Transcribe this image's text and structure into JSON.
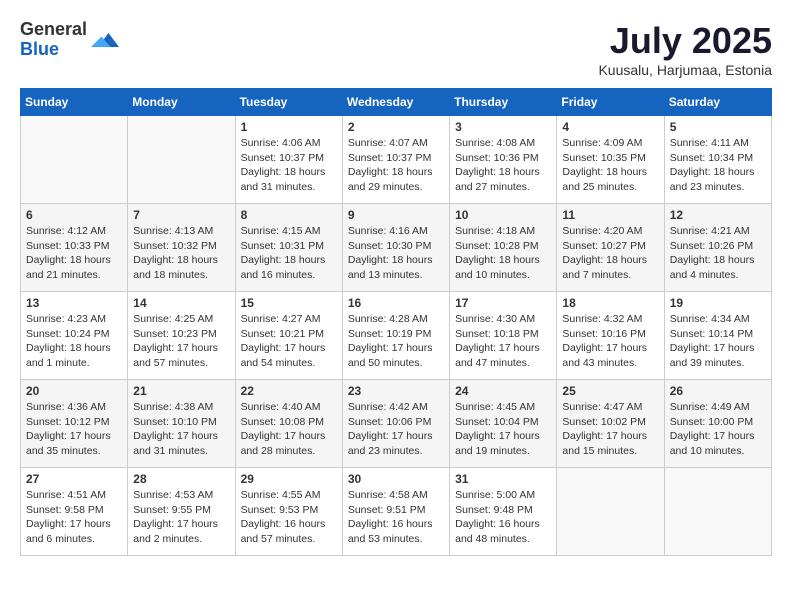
{
  "header": {
    "logo_general": "General",
    "logo_blue": "Blue",
    "month_year": "July 2025",
    "location": "Kuusalu, Harjumaa, Estonia"
  },
  "days_of_week": [
    "Sunday",
    "Monday",
    "Tuesday",
    "Wednesday",
    "Thursday",
    "Friday",
    "Saturday"
  ],
  "weeks": [
    [
      {
        "day": "",
        "sunrise": "",
        "sunset": "",
        "daylight": "",
        "empty": true
      },
      {
        "day": "",
        "sunrise": "",
        "sunset": "",
        "daylight": "",
        "empty": true
      },
      {
        "day": "1",
        "sunrise": "Sunrise: 4:06 AM",
        "sunset": "Sunset: 10:37 PM",
        "daylight": "Daylight: 18 hours and 31 minutes."
      },
      {
        "day": "2",
        "sunrise": "Sunrise: 4:07 AM",
        "sunset": "Sunset: 10:37 PM",
        "daylight": "Daylight: 18 hours and 29 minutes."
      },
      {
        "day": "3",
        "sunrise": "Sunrise: 4:08 AM",
        "sunset": "Sunset: 10:36 PM",
        "daylight": "Daylight: 18 hours and 27 minutes."
      },
      {
        "day": "4",
        "sunrise": "Sunrise: 4:09 AM",
        "sunset": "Sunset: 10:35 PM",
        "daylight": "Daylight: 18 hours and 25 minutes."
      },
      {
        "day": "5",
        "sunrise": "Sunrise: 4:11 AM",
        "sunset": "Sunset: 10:34 PM",
        "daylight": "Daylight: 18 hours and 23 minutes."
      }
    ],
    [
      {
        "day": "6",
        "sunrise": "Sunrise: 4:12 AM",
        "sunset": "Sunset: 10:33 PM",
        "daylight": "Daylight: 18 hours and 21 minutes."
      },
      {
        "day": "7",
        "sunrise": "Sunrise: 4:13 AM",
        "sunset": "Sunset: 10:32 PM",
        "daylight": "Daylight: 18 hours and 18 minutes."
      },
      {
        "day": "8",
        "sunrise": "Sunrise: 4:15 AM",
        "sunset": "Sunset: 10:31 PM",
        "daylight": "Daylight: 18 hours and 16 minutes."
      },
      {
        "day": "9",
        "sunrise": "Sunrise: 4:16 AM",
        "sunset": "Sunset: 10:30 PM",
        "daylight": "Daylight: 18 hours and 13 minutes."
      },
      {
        "day": "10",
        "sunrise": "Sunrise: 4:18 AM",
        "sunset": "Sunset: 10:28 PM",
        "daylight": "Daylight: 18 hours and 10 minutes."
      },
      {
        "day": "11",
        "sunrise": "Sunrise: 4:20 AM",
        "sunset": "Sunset: 10:27 PM",
        "daylight": "Daylight: 18 hours and 7 minutes."
      },
      {
        "day": "12",
        "sunrise": "Sunrise: 4:21 AM",
        "sunset": "Sunset: 10:26 PM",
        "daylight": "Daylight: 18 hours and 4 minutes."
      }
    ],
    [
      {
        "day": "13",
        "sunrise": "Sunrise: 4:23 AM",
        "sunset": "Sunset: 10:24 PM",
        "daylight": "Daylight: 18 hours and 1 minute."
      },
      {
        "day": "14",
        "sunrise": "Sunrise: 4:25 AM",
        "sunset": "Sunset: 10:23 PM",
        "daylight": "Daylight: 17 hours and 57 minutes."
      },
      {
        "day": "15",
        "sunrise": "Sunrise: 4:27 AM",
        "sunset": "Sunset: 10:21 PM",
        "daylight": "Daylight: 17 hours and 54 minutes."
      },
      {
        "day": "16",
        "sunrise": "Sunrise: 4:28 AM",
        "sunset": "Sunset: 10:19 PM",
        "daylight": "Daylight: 17 hours and 50 minutes."
      },
      {
        "day": "17",
        "sunrise": "Sunrise: 4:30 AM",
        "sunset": "Sunset: 10:18 PM",
        "daylight": "Daylight: 17 hours and 47 minutes."
      },
      {
        "day": "18",
        "sunrise": "Sunrise: 4:32 AM",
        "sunset": "Sunset: 10:16 PM",
        "daylight": "Daylight: 17 hours and 43 minutes."
      },
      {
        "day": "19",
        "sunrise": "Sunrise: 4:34 AM",
        "sunset": "Sunset: 10:14 PM",
        "daylight": "Daylight: 17 hours and 39 minutes."
      }
    ],
    [
      {
        "day": "20",
        "sunrise": "Sunrise: 4:36 AM",
        "sunset": "Sunset: 10:12 PM",
        "daylight": "Daylight: 17 hours and 35 minutes."
      },
      {
        "day": "21",
        "sunrise": "Sunrise: 4:38 AM",
        "sunset": "Sunset: 10:10 PM",
        "daylight": "Daylight: 17 hours and 31 minutes."
      },
      {
        "day": "22",
        "sunrise": "Sunrise: 4:40 AM",
        "sunset": "Sunset: 10:08 PM",
        "daylight": "Daylight: 17 hours and 28 minutes."
      },
      {
        "day": "23",
        "sunrise": "Sunrise: 4:42 AM",
        "sunset": "Sunset: 10:06 PM",
        "daylight": "Daylight: 17 hours and 23 minutes."
      },
      {
        "day": "24",
        "sunrise": "Sunrise: 4:45 AM",
        "sunset": "Sunset: 10:04 PM",
        "daylight": "Daylight: 17 hours and 19 minutes."
      },
      {
        "day": "25",
        "sunrise": "Sunrise: 4:47 AM",
        "sunset": "Sunset: 10:02 PM",
        "daylight": "Daylight: 17 hours and 15 minutes."
      },
      {
        "day": "26",
        "sunrise": "Sunrise: 4:49 AM",
        "sunset": "Sunset: 10:00 PM",
        "daylight": "Daylight: 17 hours and 10 minutes."
      }
    ],
    [
      {
        "day": "27",
        "sunrise": "Sunrise: 4:51 AM",
        "sunset": "Sunset: 9:58 PM",
        "daylight": "Daylight: 17 hours and 6 minutes."
      },
      {
        "day": "28",
        "sunrise": "Sunrise: 4:53 AM",
        "sunset": "Sunset: 9:55 PM",
        "daylight": "Daylight: 17 hours and 2 minutes."
      },
      {
        "day": "29",
        "sunrise": "Sunrise: 4:55 AM",
        "sunset": "Sunset: 9:53 PM",
        "daylight": "Daylight: 16 hours and 57 minutes."
      },
      {
        "day": "30",
        "sunrise": "Sunrise: 4:58 AM",
        "sunset": "Sunset: 9:51 PM",
        "daylight": "Daylight: 16 hours and 53 minutes."
      },
      {
        "day": "31",
        "sunrise": "Sunrise: 5:00 AM",
        "sunset": "Sunset: 9:48 PM",
        "daylight": "Daylight: 16 hours and 48 minutes."
      },
      {
        "day": "",
        "sunrise": "",
        "sunset": "",
        "daylight": "",
        "empty": true
      },
      {
        "day": "",
        "sunrise": "",
        "sunset": "",
        "daylight": "",
        "empty": true
      }
    ]
  ]
}
